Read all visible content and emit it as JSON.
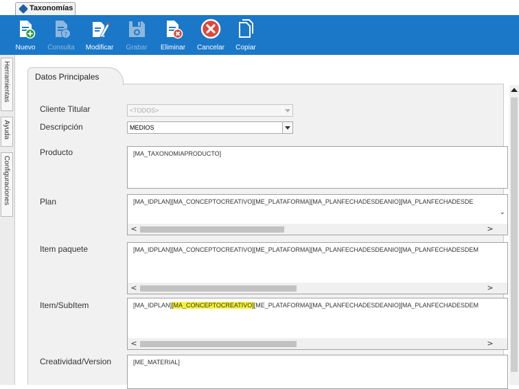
{
  "window": {
    "tab_title": "Taxonomías"
  },
  "toolbar": {
    "buttons": [
      {
        "label": "Nuevo",
        "enabled": true,
        "icon": "new-document-icon"
      },
      {
        "label": "Consulta",
        "enabled": false,
        "icon": "query-document-icon"
      },
      {
        "label": "Modificar",
        "enabled": true,
        "icon": "edit-document-icon"
      },
      {
        "label": "Grabar",
        "enabled": false,
        "icon": "save-icon"
      },
      {
        "label": "Eliminar",
        "enabled": true,
        "icon": "delete-document-icon"
      },
      {
        "label": "Cancelar",
        "enabled": true,
        "icon": "cancel-icon"
      },
      {
        "label": "Copiar",
        "enabled": true,
        "icon": "copy-icon"
      }
    ],
    "color": "#1b78c8"
  },
  "side_tabs": [
    "Herramientas",
    "Ayuda",
    "Configuraciones"
  ],
  "panel": {
    "tab_title": "Datos Principales",
    "fields": {
      "cliente_titular": {
        "label": "Cliente Titular",
        "value": "<TODOS>",
        "enabled": false
      },
      "descripcion": {
        "label": "Descripción",
        "value": "MEDIOS",
        "enabled": true
      },
      "producto": {
        "label": "Producto",
        "value": "[MA_TAXONOMIAPRODUCTO]"
      },
      "plan": {
        "label": "Plan",
        "value": "[MA_IDPLAN][MA_CONCEPTOCREATIVO][ME_PLATAFORMA][MA_PLANFECHADESDEANIO][MA_PLANFECHADESDE"
      },
      "item_paquete": {
        "label": "Item paquete",
        "value": "[MA_IDPLAN][MA_CONCEPTOCREATIVO][ME_PLATAFORMA][MA_PLANFECHADESDEANIO][MA_PLANFECHADESDEM"
      },
      "item_subitem": {
        "label": "Item/SubItem",
        "value_before": "[MA_IDPLAN]",
        "value_highlight": "[MA_CONCEPTOCREATIVO]",
        "value_after": "[ME_PLATAFORMA][MA_PLANFECHADESDEANIO][MA_PLANFECHADESDEM",
        "highlight_color": "#f6f23a"
      },
      "creatividad": {
        "label": "Creatividad/Version",
        "value": "[ME_MATERIAL]"
      }
    }
  },
  "scroll_glyphs": {
    "left": "<",
    "right": ">",
    "down": "⌄"
  }
}
